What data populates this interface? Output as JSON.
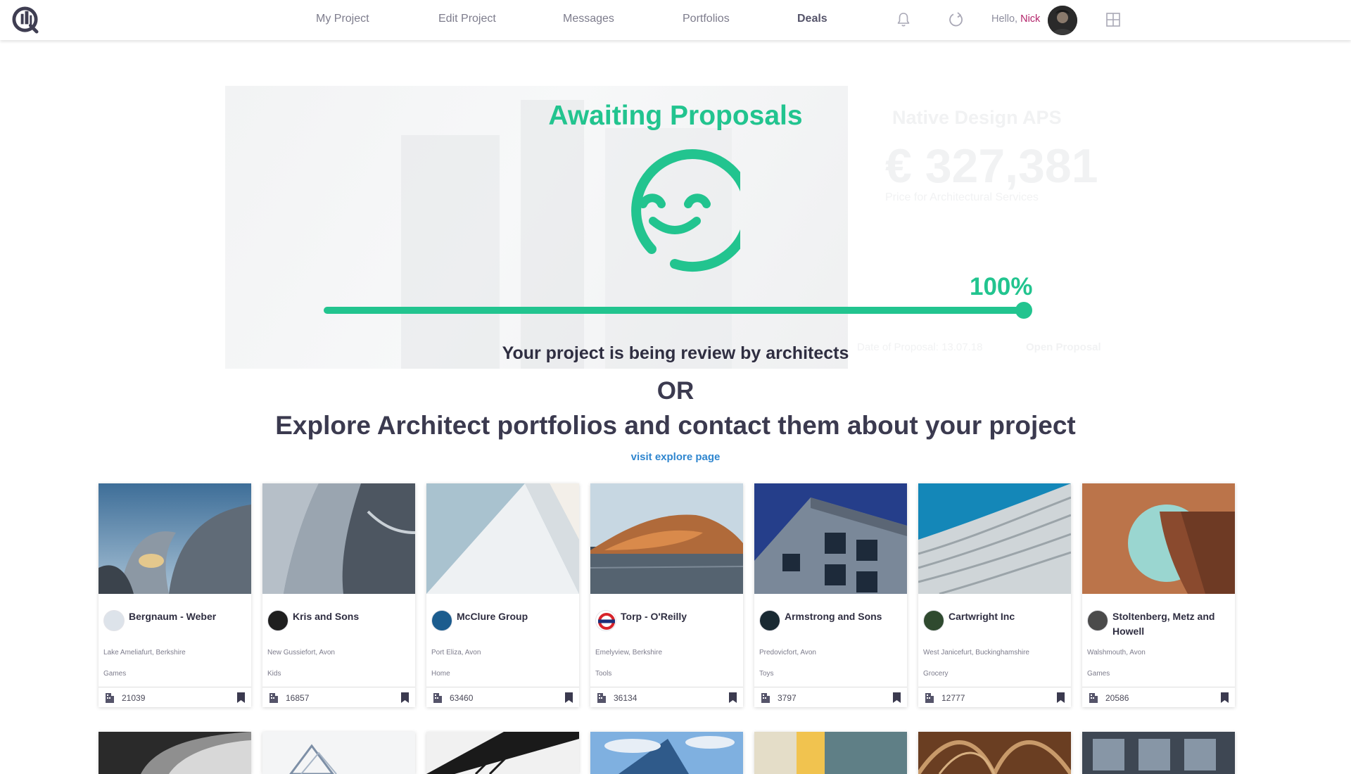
{
  "nav": {
    "links": [
      {
        "label": "My Project",
        "active": false
      },
      {
        "label": "Edit Project",
        "active": false
      },
      {
        "label": "Messages",
        "active": false
      },
      {
        "label": "Portfolios",
        "active": false
      },
      {
        "label": "Deals",
        "active": true
      }
    ],
    "greeting": "Hello,",
    "user_name": "Nick",
    "icons": [
      "bell-icon",
      "refresh-icon",
      "grid-icon"
    ]
  },
  "hero": {
    "background_card": {
      "company": "Native Design APS",
      "price": "€ 327,381",
      "price_caption": "Price for Architectural Services",
      "date_text": "Date of Proposal: 13.07.18",
      "open_label": "Open Proposal"
    },
    "title": "Awaiting Proposals",
    "progress": {
      "label": "100%",
      "value": 1.0
    },
    "review_text": "Your project is being review by architects",
    "or_text": "OR",
    "explore_text": "Explore Architect portfolios and contact them about your project",
    "visit_link": "visit explore page"
  },
  "colors": {
    "accent": "#22c48f",
    "text": "#2f2e41",
    "link": "#2f86cf",
    "name_highlight": "#b4246b"
  },
  "cards": [
    {
      "name": "Bergnaum - Weber",
      "location": "Lake Ameliafurt, Berkshire",
      "category": "Games",
      "count": "21039"
    },
    {
      "name": "Kris and Sons",
      "location": "New Gussiefort, Avon",
      "category": "Kids",
      "count": "16857"
    },
    {
      "name": "McClure Group",
      "location": "Port Eliza, Avon",
      "category": "Home",
      "count": "63460"
    },
    {
      "name": "Torp - O'Reilly",
      "location": "Emelyview, Berkshire",
      "category": "Tools",
      "count": "36134"
    },
    {
      "name": "Armstrong and Sons",
      "location": "Predovicfort, Avon",
      "category": "Toys",
      "count": "3797"
    },
    {
      "name": "Cartwright Inc",
      "location": "West Janicefurt, Buckinghamshire",
      "category": "Grocery",
      "count": "12777"
    },
    {
      "name": "Stoltenberg, Metz and Howell",
      "location": "Walshmouth, Avon",
      "category": "Games",
      "count": "20586"
    }
  ]
}
